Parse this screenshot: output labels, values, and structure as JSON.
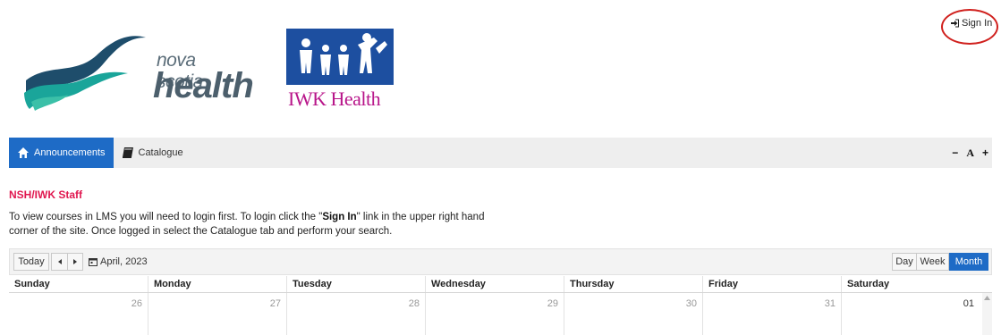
{
  "header": {
    "sign_in_label": "Sign In",
    "nsh_logo": {
      "line1": "nova scotia",
      "line2": "health"
    },
    "iwk_logo": {
      "text": "IWK Health"
    }
  },
  "nav": {
    "items": [
      {
        "label": "Announcements",
        "icon": "home-icon",
        "active": true
      },
      {
        "label": "Catalogue",
        "icon": "book-icon",
        "active": false
      }
    ],
    "font_controls": {
      "decrease": "−",
      "label": "A",
      "increase": "+"
    }
  },
  "content": {
    "title": "NSH/IWK Staff",
    "intro_before": "To view courses in LMS you will need to login first. To login click the \"",
    "intro_bold": "Sign In",
    "intro_after": "\" link in the upper right hand corner of the site. Once logged in select the Catalogue tab and perform your search."
  },
  "calendar": {
    "today_label": "Today",
    "prev_icon": "caret-left-icon",
    "next_icon": "caret-right-icon",
    "current_month": "April, 2023",
    "views": {
      "day": "Day",
      "week": "Week",
      "month": "Month"
    },
    "active_view": "Month",
    "weekdays": [
      "Sunday",
      "Monday",
      "Tuesday",
      "Wednesday",
      "Thursday",
      "Friday",
      "Saturday"
    ],
    "first_week_dates": [
      "26",
      "27",
      "28",
      "29",
      "30",
      "31",
      "01"
    ]
  },
  "colors": {
    "accent": "#1e6bc6",
    "staff_title": "#e0174f",
    "iwk_blue": "#1d4fa0",
    "iwk_magenta": "#b8168a",
    "nsh_teal": "#1aa59a",
    "annotation_red": "#d0201d"
  }
}
